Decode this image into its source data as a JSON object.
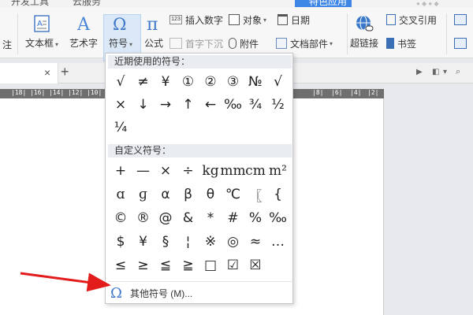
{
  "menu": {
    "items": [
      "开发工具",
      "云服务"
    ],
    "highlight": "特色应用"
  },
  "ribbon": {
    "partial_label": "注",
    "textbox": "文本框",
    "wordart": "艺术字",
    "symbol": "符号",
    "formula": "公式",
    "insert_number": "插入数字",
    "first_sink": "首字下沉",
    "object": "对象",
    "attachment": "附件",
    "date": "日期",
    "doc_parts": "文档部件",
    "hyperlink": "超链接",
    "cross_ref": "交叉引用",
    "bookmark": "书签",
    "num_badge": "123"
  },
  "tabbar": {
    "close": "×",
    "add": "+"
  },
  "ruler": {
    "labels": [
      "|18|",
      "|16|",
      "|14|",
      "|12|",
      "|10|",
      "|8|",
      "|6|",
      "|4|",
      "|2|"
    ]
  },
  "dropdown": {
    "recent_header": "近期使用的符号：",
    "recent": [
      "√",
      "≠",
      "¥",
      "①",
      "②",
      "③",
      "№",
      "√",
      "×",
      "↓",
      "→",
      "↑",
      "←",
      "‰",
      "¾",
      "½",
      "¼"
    ],
    "custom_header": "自定义符号：",
    "custom": [
      "+",
      "—",
      "×",
      "÷",
      "kg",
      "mm",
      "cm",
      "m²",
      "ɑ",
      "ɡ",
      "α",
      "β",
      "θ",
      "℃",
      "〖",
      "{",
      "©",
      "®",
      "@",
      "&",
      "*",
      "#",
      "%",
      "‰",
      "$",
      "¥",
      "§",
      "¦",
      "※",
      "◎",
      "≈",
      "…",
      "≤",
      "≥",
      "≦",
      "≧",
      "□",
      "☑",
      "☒"
    ],
    "more_icon": "Ω",
    "more_label": "其他符号 (M)..."
  }
}
